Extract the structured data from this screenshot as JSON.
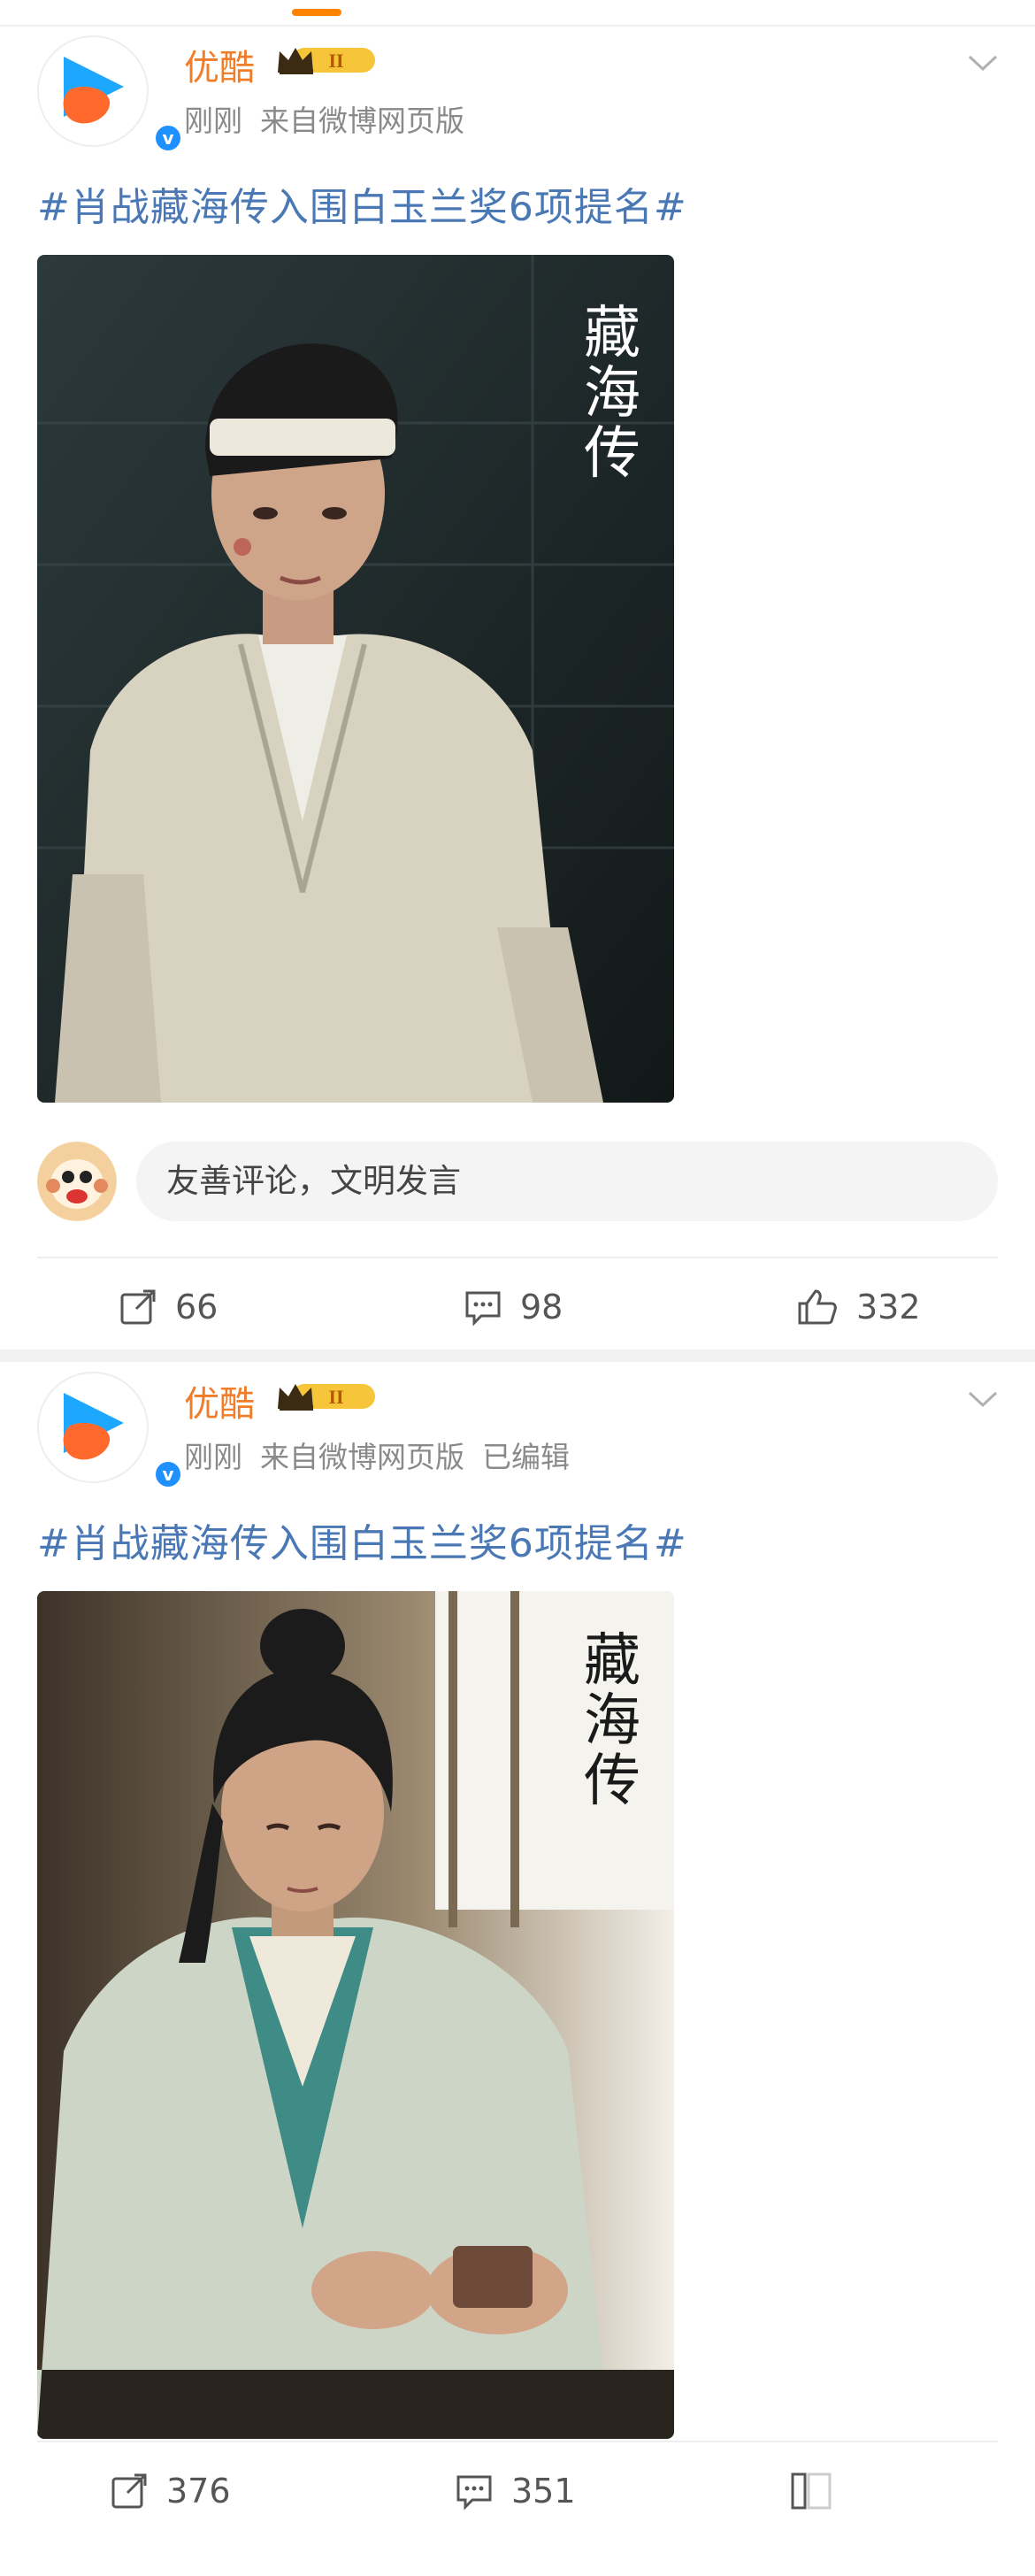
{
  "posts": [
    {
      "username": "优酷",
      "badge_level": "II",
      "time": "刚刚",
      "source": "来自微博网页版",
      "edited": "",
      "text": "#肖战藏海传入围白玉兰奖6项提名#",
      "image_title": "藏\n海\n传",
      "comment_placeholder": "友善评论，文明发言",
      "actions": {
        "repost": "66",
        "comment": "98",
        "like": "332"
      }
    },
    {
      "username": "优酷",
      "badge_level": "II",
      "time": "刚刚",
      "source": "来自微博网页版",
      "edited": "已编辑",
      "text": "#肖战藏海传入围白玉兰奖6项提名#",
      "image_title": "藏\n海\n传",
      "actions": {
        "repost": "376",
        "comment": "351"
      }
    }
  ],
  "colors": {
    "username": "#f07d2a",
    "topic": "#4a78b5",
    "accent": "#ff8200",
    "verified": "#1e90ff"
  },
  "icons": [
    "youku-logo-icon",
    "verified-icon",
    "crown-badge-icon",
    "chevron-down-icon",
    "repost-icon",
    "comment-icon",
    "like-icon",
    "collect-icon"
  ]
}
